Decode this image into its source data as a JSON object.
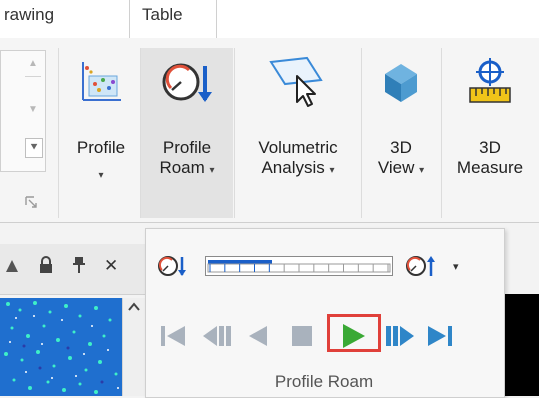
{
  "tabs": [
    {
      "label": "rawing"
    },
    {
      "label": "Table"
    }
  ],
  "ribbon": {
    "buttons": [
      {
        "line1": "Profile",
        "line2": "▾",
        "icon": "profile-chart-icon"
      },
      {
        "line1": "Profile",
        "line2": "Roam",
        "caret": "▾",
        "icon": "profile-roam-icon"
      },
      {
        "line1": "Volumetric",
        "line2": "Analysis",
        "caret": "▾",
        "icon": "volumetric-analysis-icon"
      },
      {
        "line1": "3D",
        "line2": "View",
        "caret": "▾",
        "icon": "3d-view-cube-icon"
      },
      {
        "line1": "3D",
        "line2": "Measure",
        "icon": "3d-measure-icon"
      }
    ],
    "gallery": {
      "up": "▲",
      "down": "▼",
      "more": "⯆"
    }
  },
  "panel": {
    "icons": [
      "triangle-icon",
      "lock-icon",
      "pin-icon",
      "close-icon"
    ],
    "close": "✕"
  },
  "profile_roam": {
    "title": "Profile Roam",
    "progress": 0.35,
    "controls": [
      "first-icon",
      "step-back-icon",
      "reverse-icon",
      "stop-icon",
      "play-icon",
      "step-forward-icon",
      "last-icon"
    ],
    "dropdown": "▾"
  },
  "colors": {
    "accent_blue": "#1a5fc8",
    "control_gray": "#a9b2bd",
    "play_green": "#3aa935",
    "highlight_red": "#e0403a"
  }
}
